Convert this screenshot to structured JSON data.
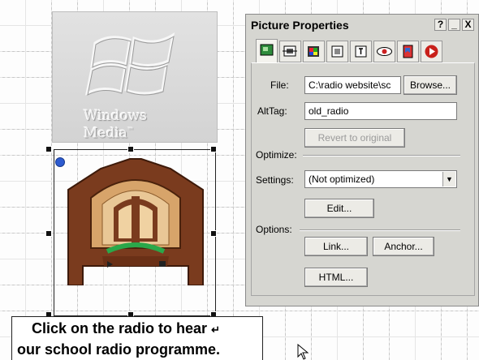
{
  "canvas": {
    "windows_media_image": {
      "text_line1": "Windows",
      "text_line2": "Media",
      "trademark": "™"
    },
    "radio_image": {
      "icon": "radio-icon"
    },
    "caption": {
      "line1": "Click on the radio to hear",
      "line2": "our school radio programme.",
      "return_mark": "↵"
    }
  },
  "dialog": {
    "title": "Picture Properties",
    "title_buttons": {
      "help": "?",
      "minimize": "_",
      "close": "X"
    },
    "tabs": [
      {
        "name": "picture-tab-icon",
        "active": true
      },
      {
        "name": "layout-tab-icon"
      },
      {
        "name": "color-tab-icon"
      },
      {
        "name": "effects-tab-icon"
      },
      {
        "name": "text-tab-icon"
      },
      {
        "name": "view-tab-icon"
      },
      {
        "name": "hotspot-tab-icon"
      },
      {
        "name": "record-tab-icon"
      }
    ],
    "file": {
      "label": "File:",
      "value": "C:\\radio website\\sc",
      "browse_label": "Browse..."
    },
    "alt_tag": {
      "label": "AltTag:",
      "value": "old_radio"
    },
    "revert_label": "Revert to original",
    "optimize": {
      "section_label": "Optimize:",
      "settings_label": "Settings:",
      "settings_value": "(Not optimized)",
      "edit_label": "Edit..."
    },
    "options": {
      "section_label": "Options:",
      "link_label": "Link...",
      "anchor_label": "Anchor...",
      "html_label": "HTML..."
    }
  },
  "colors": {
    "dialog_bg": "#d6d6d1",
    "radio_wood": "#7a3b1e",
    "radio_accent": "#2aa84a"
  }
}
